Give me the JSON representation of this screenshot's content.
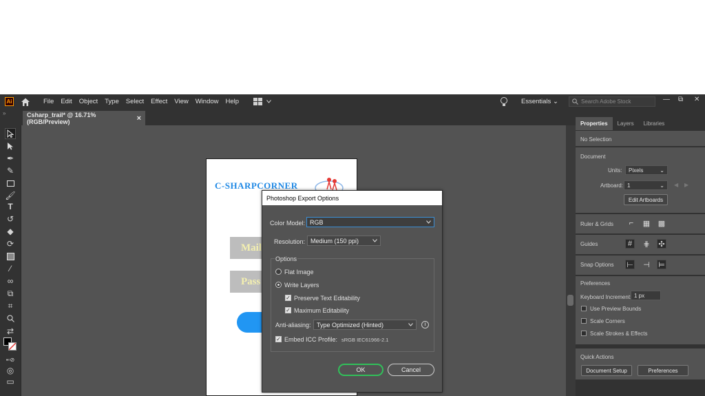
{
  "app": {
    "logo_text": "Ai"
  },
  "menu": {
    "items": [
      "File",
      "Edit",
      "Object",
      "Type",
      "Select",
      "Effect",
      "View",
      "Window",
      "Help"
    ]
  },
  "workspace": {
    "name": "Essentials",
    "search_placeholder": "Search Adobe Stock"
  },
  "window_controls": [
    "—",
    "⧉",
    "✕"
  ],
  "document_tab": {
    "label": "Csharp_trail* @ 16.71% (RGB/Preview)",
    "close": "×"
  },
  "artboard": {
    "logo_text": "C-SHARPCORNER",
    "field1": "Mail",
    "field2": "Pass"
  },
  "properties": {
    "tabs": [
      "Properties",
      "Layers",
      "Libraries"
    ],
    "selection": "No Selection",
    "document_heading": "Document",
    "units_label": "Units:",
    "units_value": "Pixels",
    "artboard_label": "Artboard:",
    "artboard_value": "1",
    "edit_artboards": "Edit Artboards",
    "ruler_grids": "Ruler & Grids",
    "guides": "Guides",
    "snap_options": "Snap Options",
    "preferences_heading": "Preferences",
    "keyboard_increment_label": "Keyboard Increment:",
    "keyboard_increment_value": "1 px",
    "use_preview_bounds": "Use Preview Bounds",
    "scale_corners": "Scale Corners",
    "scale_strokes": "Scale Strokes & Effects",
    "quick_actions": "Quick Actions",
    "document_setup": "Document Setup",
    "preferences_button": "Preferences"
  },
  "dialog": {
    "title": "Photoshop Export Options",
    "color_model_label": "Color Model:",
    "color_model_value": "RGB",
    "resolution_label": "Resolution:",
    "resolution_value": "Medium (150 ppi)",
    "options_label": "Options",
    "flat_image": "Flat Image",
    "write_layers": "Write Layers",
    "preserve_text": "Preserve Text Editability",
    "max_editability": "Maximum Editability",
    "anti_aliasing_label": "Anti-aliasing:",
    "anti_aliasing_value": "Type Optimized (Hinted)",
    "embed_icc_label": "Embed ICC Profile:",
    "embed_icc_value": "sRGB IEC61966-2.1",
    "ok": "OK",
    "cancel": "Cancel"
  }
}
